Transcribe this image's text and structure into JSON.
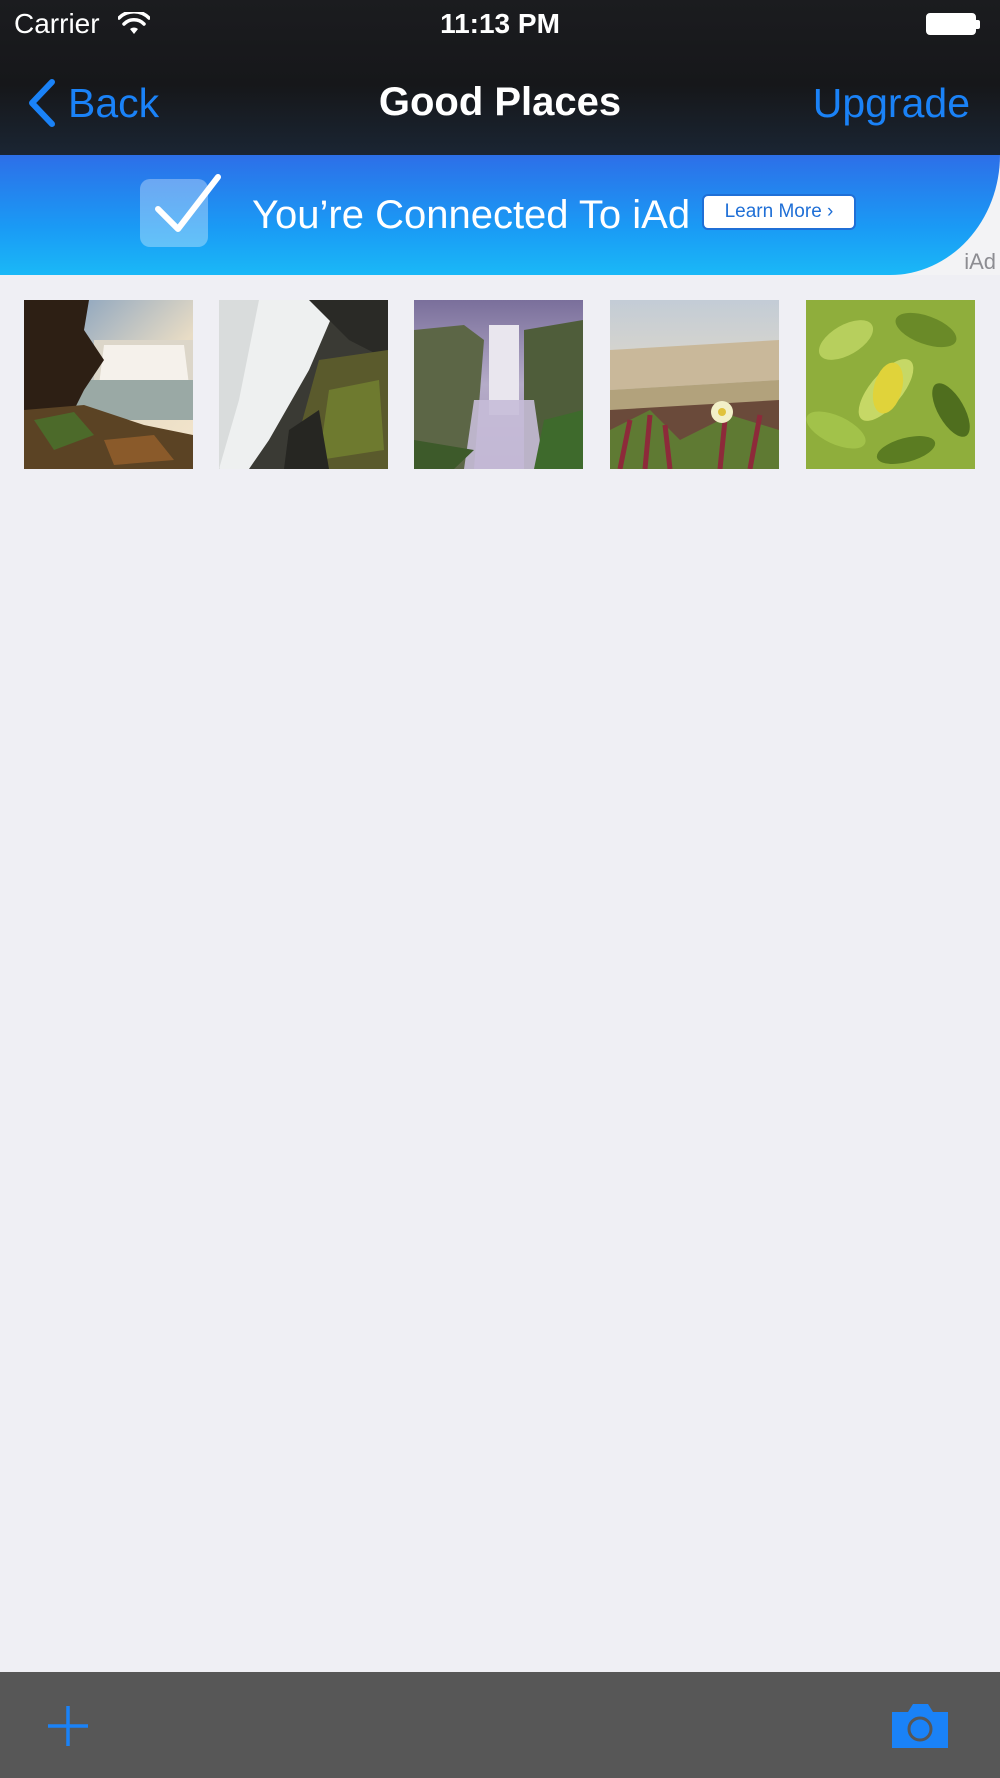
{
  "status_bar": {
    "carrier": "Carrier",
    "time": "11:13 PM",
    "wifi_icon": "wifi-icon",
    "battery_icon": "battery-icon"
  },
  "nav": {
    "back_label": "Back",
    "title": "Good Places",
    "upgrade_label": "Upgrade",
    "accent_color": "#1a82f7"
  },
  "ad": {
    "text": "You’re Connected To iAd",
    "button_label": "Learn More ›",
    "badge": "iAd"
  },
  "photos": [
    {
      "name": "waterfall-cliff"
    },
    {
      "name": "waterfall-closeup"
    },
    {
      "name": "waterfall-mist"
    },
    {
      "name": "beach-flower"
    },
    {
      "name": "green-leaves"
    }
  ],
  "toolbar": {
    "add_icon": "plus-icon",
    "camera_icon": "camera-icon"
  }
}
